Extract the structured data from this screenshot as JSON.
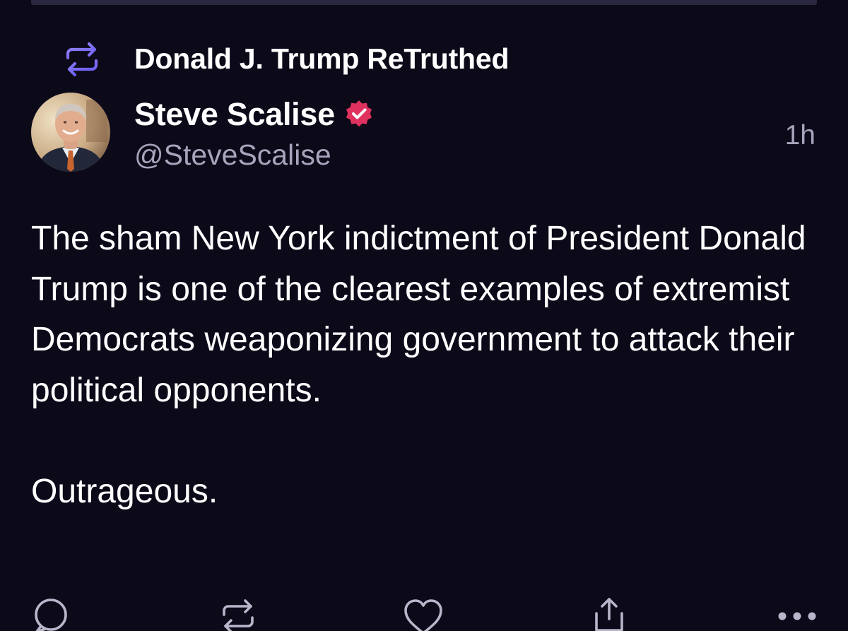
{
  "header": {
    "retruth_text": "Donald J. Trump ReTruthed"
  },
  "author": {
    "display_name": "Steve Scalise",
    "handle": "@SteveScalise",
    "verified": true,
    "timestamp": "1h"
  },
  "post": {
    "paragraphs": [
      "The sham New York indictment of President Donald Trump is one of the clearest examples of extremist Democrats weaponizing government to attack their political opponents.",
      "Outrageous."
    ]
  },
  "actions": [
    {
      "name": "reply",
      "icon": "reply-icon"
    },
    {
      "name": "retruth",
      "icon": "retruth-icon"
    },
    {
      "name": "like",
      "icon": "heart-icon"
    },
    {
      "name": "share",
      "icon": "share-icon"
    },
    {
      "name": "more",
      "icon": "more-icon"
    }
  ],
  "colors": {
    "background": "#0c0919",
    "accent": "#7a6df5",
    "verified": "#e0325f",
    "secondary_text": "#a7a4bc",
    "icon": "#b9b6cc"
  }
}
